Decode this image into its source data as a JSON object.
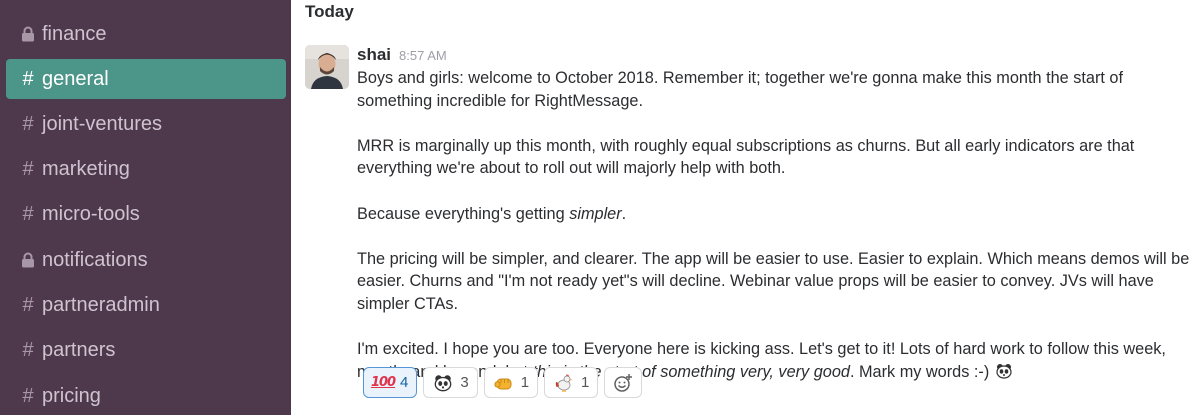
{
  "sidebar": {
    "channels": [
      {
        "name": "finance",
        "private": true,
        "active": false
      },
      {
        "name": "general",
        "private": false,
        "active": true
      },
      {
        "name": "joint-ventures",
        "private": false,
        "active": false
      },
      {
        "name": "marketing",
        "private": false,
        "active": false
      },
      {
        "name": "micro-tools",
        "private": false,
        "active": false
      },
      {
        "name": "notifications",
        "private": true,
        "active": false
      },
      {
        "name": "partneradmin",
        "private": false,
        "active": false
      },
      {
        "name": "partners",
        "private": false,
        "active": false
      },
      {
        "name": "pricing",
        "private": false,
        "active": false
      }
    ],
    "hash": "#",
    "colors": {
      "background": "#4d394b",
      "active": "#4c9689"
    }
  },
  "main": {
    "day_header": "Today",
    "message": {
      "sender": "shai",
      "time": "8:57 AM",
      "p1": "Boys and girls: welcome to October 2018. Remember it; together we're gonna make this month the start of something incredible for RightMessage.",
      "p2": "MRR is marginally up this month, with roughly equal subscriptions as churns. But all early indicators are that everything we're about to roll out will majorly help with both.",
      "p3_start": "Because everything's getting ",
      "p3_em": "simpler",
      "p3_end": ".",
      "p4": "The pricing will be simpler, and clearer. The app will be easier to use. Easier to explain. Which means demos will be easier. Churns and \"I'm not ready yet\"s will decline. Webinar value props will be easier to convey. JVs will have simpler CTAs.",
      "p5_start": "I'm excited. I hope you are too. Everyone here is kicking ass. Let's get to it! Lots of hard work to follow this week, month, and beyond, but ",
      "p5_em": "this is the start of something very, very good",
      "p5_end": ". Mark my words :-) "
    },
    "reactions": [
      {
        "emoji": "100-icon",
        "glyph": "100",
        "count": "4",
        "mine": true
      },
      {
        "emoji": "panda-icon",
        "count": "3",
        "mine": false
      },
      {
        "emoji": "fist-icon",
        "count": "1",
        "mine": false
      },
      {
        "emoji": "rooster-icon",
        "count": "1",
        "mine": false
      }
    ]
  }
}
